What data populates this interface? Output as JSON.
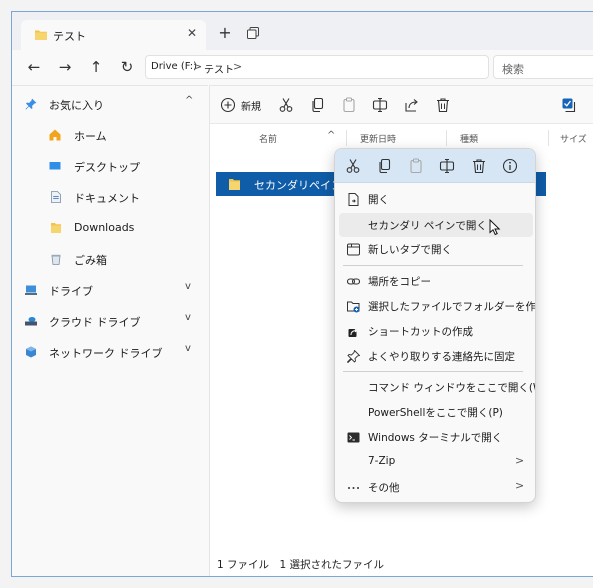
{
  "tab": {
    "title": "テスト",
    "close": "✕"
  },
  "tabstrip": {
    "new_tab": "+"
  },
  "nav": {
    "back": "←",
    "forward": "→",
    "up": "↑",
    "refresh": "↻"
  },
  "address": {
    "crumbs": [
      "Drive (F:)",
      "テスト"
    ],
    "sep": ">"
  },
  "search": {
    "placeholder": "検索"
  },
  "sidebar": {
    "items": [
      {
        "label": "お気に入り",
        "chevron": "^"
      },
      {
        "label": "ホーム"
      },
      {
        "label": "デスクトップ"
      },
      {
        "label": "ドキュメント"
      },
      {
        "label": "Downloads"
      },
      {
        "label": "ごみ箱"
      },
      {
        "label": "ドライブ",
        "chevron": "v"
      },
      {
        "label": "クラウド ドライブ",
        "chevron": "v"
      },
      {
        "label": "ネットワーク ドライブ",
        "chevron": "v"
      }
    ]
  },
  "toolbar": {
    "new_label": "新規"
  },
  "columns": {
    "name": "名前",
    "modified": "更新日時",
    "type": "種類",
    "size": "サイズ"
  },
  "files": [
    {
      "name": "セカンダリペイン"
    }
  ],
  "status": {
    "text": "1 ファイル　1 選択されたファイル"
  },
  "context_menu": {
    "items": [
      {
        "label": "開く",
        "icon": "open-icon"
      },
      {
        "label": "セカンダリ ペインで開く",
        "icon": "none"
      },
      {
        "label": "新しいタブで開く",
        "icon": "new-tab-icon"
      },
      {
        "label": "場所をコピー",
        "icon": "link-icon"
      },
      {
        "label": "選択したファイルでフォルダーを作成",
        "icon": "folder-add-icon"
      },
      {
        "label": "ショートカットの作成",
        "icon": "shortcut-icon"
      },
      {
        "label": "よくやり取りする連絡先に固定",
        "icon": "pin-icon"
      },
      {
        "label": "コマンド ウィンドウをここで開く(W)",
        "icon": "none"
      },
      {
        "label": "PowerShellをここで開く(P)",
        "icon": "none"
      },
      {
        "label": "Windows ターミナルで開く",
        "icon": "terminal-icon"
      },
      {
        "label": "7-Zip",
        "icon": "none",
        "arrow": ">"
      },
      {
        "label": "その他",
        "icon": "more-icon",
        "arrow": ">"
      }
    ]
  },
  "colors": {
    "accent": "#0f5ca8",
    "menu_top": "#d6e6f5",
    "folder": "#f2c447"
  }
}
